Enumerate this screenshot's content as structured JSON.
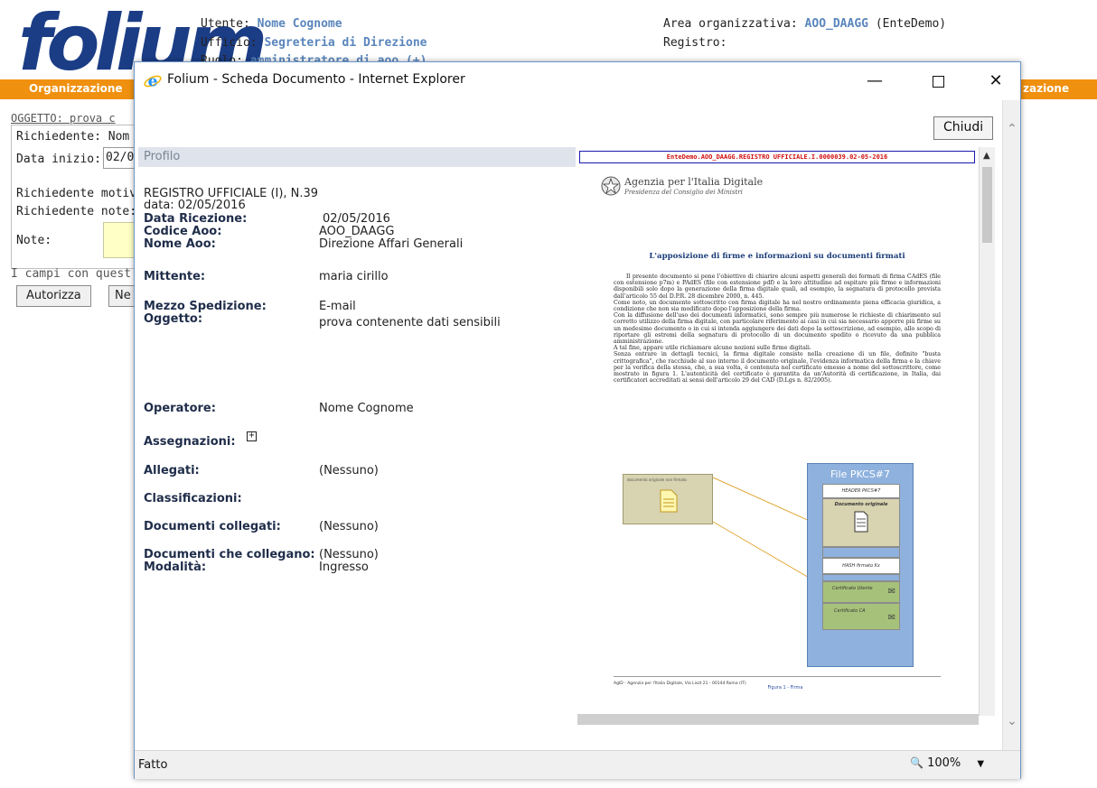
{
  "background": {
    "logo_text": "folium",
    "user_label": "Utente:",
    "user_value": "Nome Cognome",
    "office_label": "Ufficio:",
    "office_value": "Segreteria di Direzione",
    "role_label": "Ruolo:",
    "role_value": "amministratore di aoo (+)",
    "area_label": "Area organizzativa:",
    "area_value": "AOO_DAAGG",
    "area_suffix": "(EnteDemo)",
    "registro_label": "Registro:",
    "tab_left": "Organizzazione",
    "tab_right": "zazione",
    "oggetto_line": "OGGETTO: prova c",
    "richiedente": "Richiedente: Nom",
    "data_inizio_label": "Data inizio:",
    "data_inizio_value": "02/0",
    "richiedente_motivo": "Richiedente motiv",
    "richiedente_note": "Richiedente note:",
    "note_label": "Note:",
    "campi_note": "I campi con quest",
    "autorizza_button": "Autorizza",
    "second_button": "Ne"
  },
  "popup": {
    "title": "Folium - Scheda Documento - Internet Explorer",
    "minimize_icon": "minimize-icon",
    "maximize_icon": "maximize-icon",
    "close_icon": "close-icon",
    "close_button": "Chiudi",
    "section_title": "Profilo",
    "registro": "REGISTRO UFFICIALE (I), N.39",
    "data": "data: 02/05/2016",
    "fields": {
      "data_ricezione_label": "Data Ricezione:",
      "data_ricezione_value": "02/05/2016",
      "codice_aoo_label": "Codice Aoo:",
      "codice_aoo_value": "AOO_DAAGG",
      "nome_aoo_label": "Nome Aoo:",
      "nome_aoo_value": "Direzione Affari Generali",
      "mittente_label": "Mittente:",
      "mittente_value": "maria cirillo",
      "mezzo_label": "Mezzo Spedizione:",
      "mezzo_value": "E-mail",
      "oggetto_label": "Oggetto:",
      "oggetto_value": "prova contenente dati sensibili",
      "operatore_label": "Operatore:",
      "operatore_value": "Nome Cognome",
      "assegnazioni_label": "Assegnazioni:",
      "allegati_label": "Allegati:",
      "allegati_value": "(Nessuno)",
      "classificazioni_label": "Classificazioni:",
      "doc_collegati_label": "Documenti collegati:",
      "doc_collegati_value": "(Nessuno)",
      "doc_che_collegano_label": "Documenti che collegano:",
      "doc_che_collegano_value": "(Nessuno)",
      "modalita_label": "Modalità:",
      "modalita_value": "Ingresso"
    },
    "status_text": "Fatto",
    "zoom": "100%"
  },
  "pdf": {
    "banner": "EnteDemo.AOO_DAAGG.REGISTRO UFFICIALE.I.0000039.02-05-2016",
    "agency_name": "Agenzia per l'Italia Digitale",
    "agency_sub": "Presidenza del Consiglio dei Ministri",
    "heading": "L'apposizione di firme e informazioni su documenti firmati",
    "paragraphs": [
      "Il presente documento si pone l'obiettivo di chiarire alcuni aspetti generali dei formati di firma CAdES (file con estensione p7m) e PAdES (file con estensione pdf) e la loro attitudine ad ospitare più firme e informazioni disponibili solo dopo la generazione della firma digitale quali, ad esempio, la segnatura di protocollo prevista dall'articolo 55 del D.P.R. 28 dicembre 2000, n. 445.",
      "Come noto, un documento sottoscritto con firma digitale ha nel nostro ordinamento piena efficacia giuridica, a condizione che non sia modificato dopo l'apposizione della firma.",
      "Con la diffusione dell'uso dei documenti informatici, sono sempre più numerose le richieste di chiarimento sul corretto utilizzo della firma digitale, con particolare riferimento ai casi in cui sia necessario apporre più firme su un medesimo documento o in cui si intenda aggiungere dei dati dopo la sottoscrizione, ad esempio, allo scopo di riportare gli estremi della segnatura di protocollo di un documento spedito o ricevuto da una pubblica amministrazione.",
      "A tal fine, appare utile richiamare alcune nozioni sulle firme digitali.",
      "Senza entrare in dettagli tecnici, la firma digitale consiste nella creazione di un file, definito \"busta crittografica\", che racchiude al suo interno il documento originale, l'evidenza informatica della firma e la chiave per la verifica della stessa, che, a sua volta, è contenuta nel certificato emesso a nome del sottoscrittore, come mostrato in figura 1. L'autenticità del certificato è garantita da un'Autorità di certificazione, in Italia, dai certificatori accreditati ai sensi dell'articolo 29 del CAD (D.Lgs n. 82/2005)."
    ],
    "fig_left_caption": "documento originale non firmato",
    "pkcs_title": "File PKCS#7",
    "pkcs_header": "HEADER PKCS#7",
    "pkcs_doc": "Documento originale",
    "pkcs_hash": "HASH firmato Kx",
    "pkcs_cert_user": "Certificato Utente",
    "pkcs_cert_ca": "Certificato CA",
    "figure_caption": "Figura 1 - Firma",
    "footer": "AgID - Agenzia per l'Italia Digitale, Via Liszt 21 - 00144 Roma (IT)"
  },
  "colors": {
    "orange": "#f0900f",
    "label_blue": "#5a86bc",
    "ie_blue": "#1e90ff"
  }
}
